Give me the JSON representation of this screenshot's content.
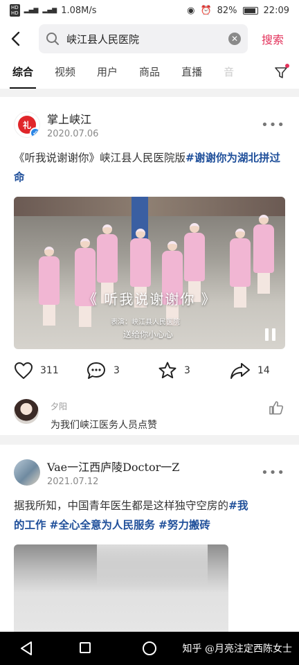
{
  "status": {
    "speed": "1.08M/s",
    "battery": "82%",
    "time": "22:09"
  },
  "search": {
    "query": "峡江县人民医院",
    "submit_label": "搜索"
  },
  "tabs": [
    {
      "label": "综合"
    },
    {
      "label": "视频"
    },
    {
      "label": "用户"
    },
    {
      "label": "商品"
    },
    {
      "label": "直播"
    },
    {
      "label": "音"
    }
  ],
  "posts": [
    {
      "author": "掌上峡江",
      "date": "2020.07.06",
      "text": "《听我说谢谢你》峡江县人民医院版",
      "hashtag": "#谢谢你为湖北拼过命",
      "video": {
        "title": "《 听我说谢谢你 》",
        "performer": "表演：峡江县人民医院",
        "caption": "送给你小心心"
      },
      "likes": "311",
      "comments": "3",
      "favorites": "3",
      "shares": "14",
      "top_comment": {
        "name": "夕阳",
        "text": "为我们峡江医务人员点赞"
      }
    },
    {
      "author": "Vae一江西庐陵Doctor一Z",
      "date": "2021.07.12",
      "text_line1": "据我所知，中国青年医生都是这样独守空房的",
      "hashtag1_a": "#我",
      "hashtag1_b": "的工作",
      "hashtag2": "#全心全意为人民服务",
      "hashtag3": "#努力搬砖"
    }
  ],
  "watermark": "知乎 @月亮注定西陈女士",
  "colors": {
    "accent": "#e3325b",
    "hashtag": "#1f4f9a"
  }
}
